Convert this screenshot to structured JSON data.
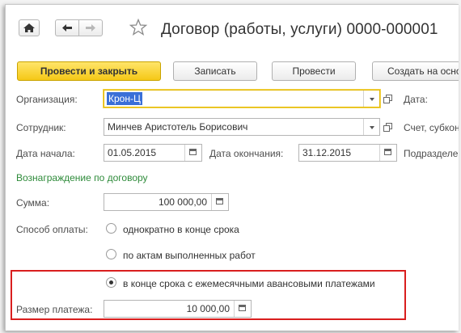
{
  "header": {
    "title": "Договор (работы, услуги) 0000-000001"
  },
  "toolbar": {
    "post_and_close": "Провести и закрыть",
    "save": "Записать",
    "post": "Провести",
    "create_based_on": "Создать на основании"
  },
  "form": {
    "organization": {
      "label": "Организация:",
      "value": "Крон-Ц"
    },
    "date": {
      "label": "Дата:"
    },
    "employee": {
      "label": "Сотрудник:",
      "value": "Минчев Аристотель Борисович"
    },
    "account": {
      "label": "Счет, субконто"
    },
    "start_date": {
      "label": "Дата начала:",
      "value": "01.05.2015"
    },
    "end_date": {
      "label": "Дата окончания:",
      "value": "31.12.2015"
    },
    "division": {
      "label": "Подразделение"
    },
    "section_title": "Вознаграждение по договору",
    "amount": {
      "label": "Сумма:",
      "value": "100 000,00"
    },
    "payment_method": {
      "label": "Способ оплаты:",
      "options": [
        {
          "label": "однократно в конце срока",
          "checked": false
        },
        {
          "label": "по актам выполненных работ",
          "checked": false
        },
        {
          "label": "в конце срока с ежемесячными авансовыми платежами",
          "checked": true
        }
      ]
    },
    "payment_size": {
      "label": "Размер платежа:",
      "value": "10 000,00"
    }
  },
  "colors": {
    "accent_yellow": "#f5c816",
    "highlight_red": "#d91e1e",
    "section_green": "#2e8b3a",
    "selection_blue": "#3a6fd8"
  }
}
